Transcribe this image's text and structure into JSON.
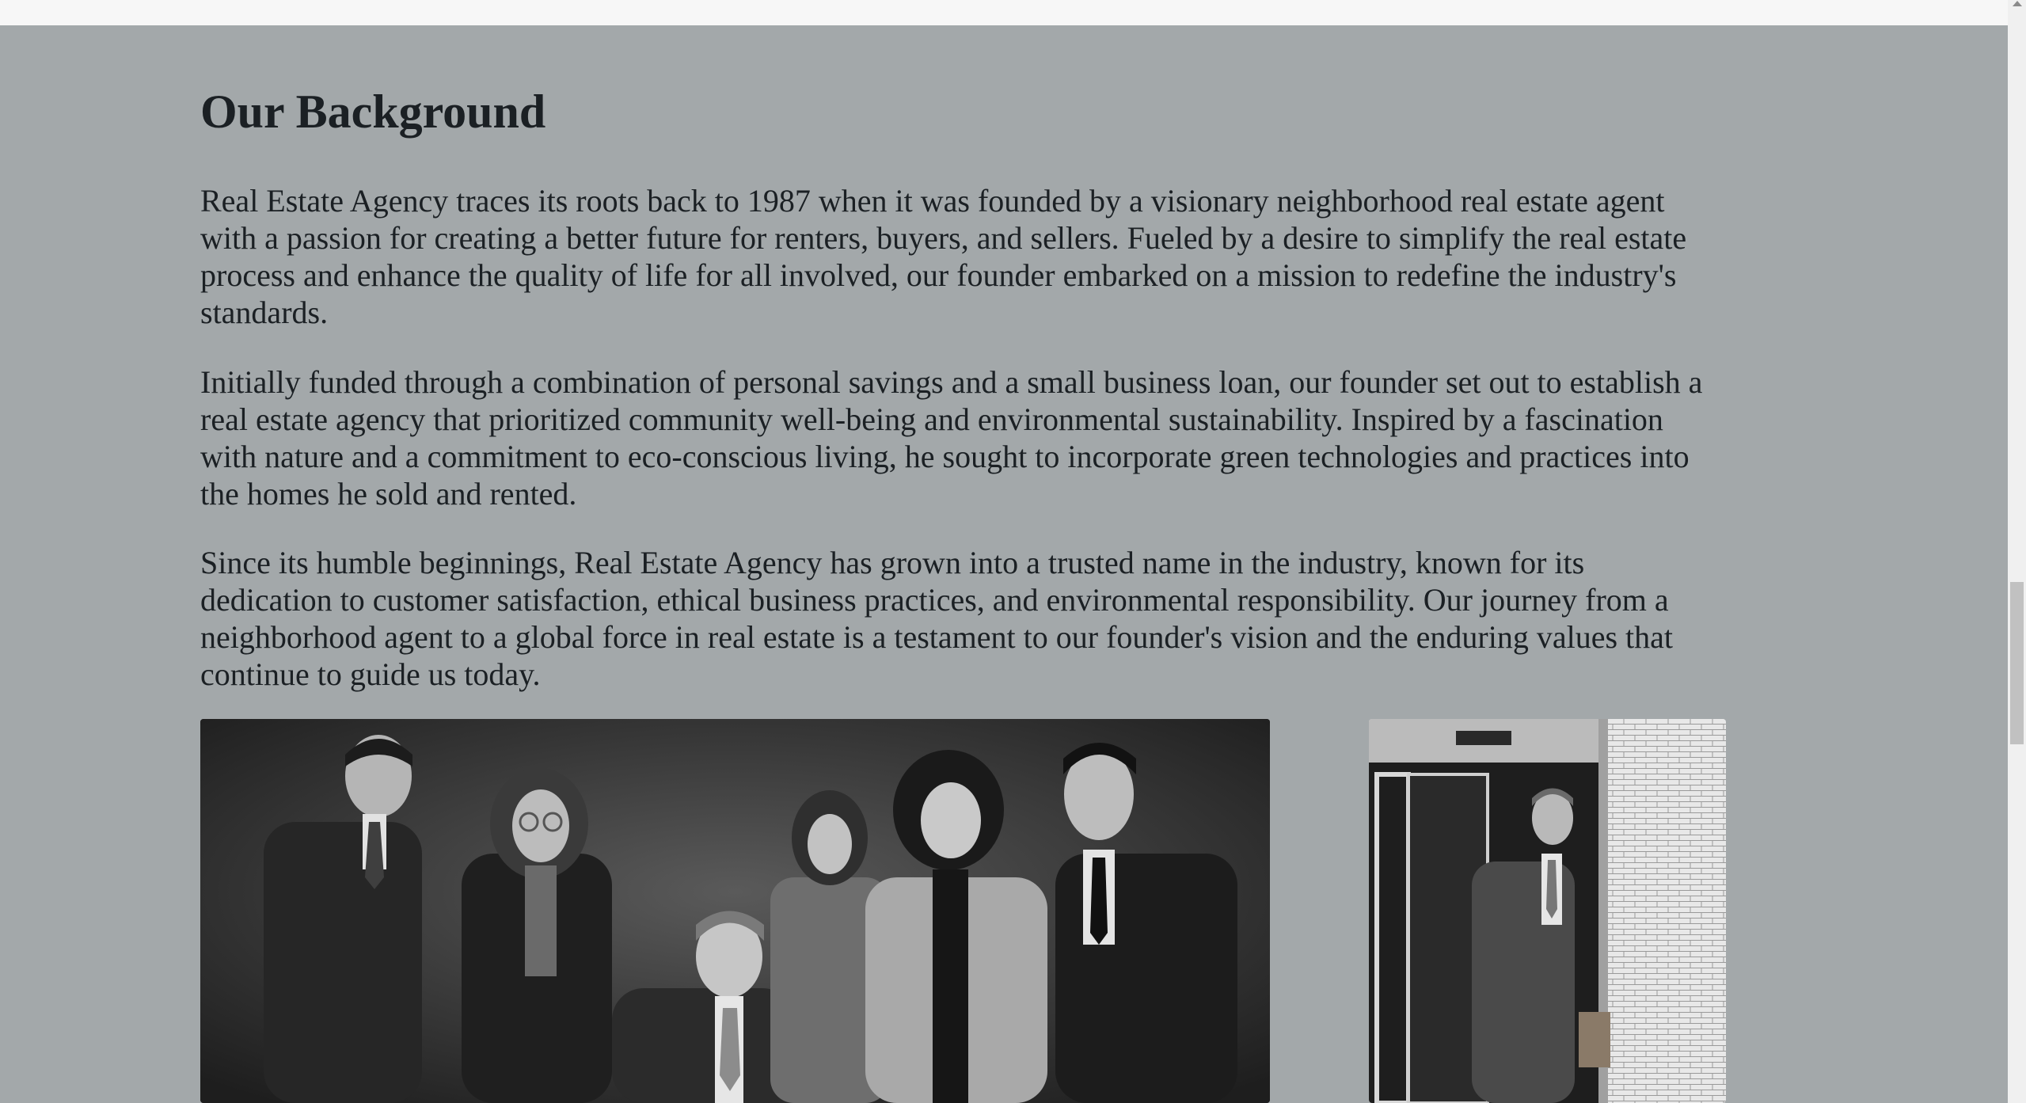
{
  "section": {
    "title": "Our Background",
    "paragraphs": [
      "Real Estate Agency traces its roots back to 1987 when it was founded by a visionary neighborhood real estate agent with a passion for creating a better future for renters, buyers, and sellers. Fueled by a desire to simplify the real estate process and enhance the quality of life for all involved, our founder embarked on a mission to redefine the industry's standards.",
      "Initially funded through a combination of personal savings and a small business loan, our founder set out to establish a real estate agency that prioritized community well-being and environmental sustainability. Inspired by a fascination with nature and a commitment to eco-conscious living, he sought to incorporate green technologies and practices into the homes he sold and rented.",
      "Since its humble beginnings, Real Estate Agency has grown into a trusted name in the industry, known for its dedication to customer satisfaction, ethical business practices, and environmental responsibility. Our journey from a neighborhood agent to a global force in real estate is a testament to our founder's vision and the enduring values that continue to guide us today."
    ]
  },
  "colors": {
    "background": "#a3a8aa",
    "text": "#1b2024"
  }
}
